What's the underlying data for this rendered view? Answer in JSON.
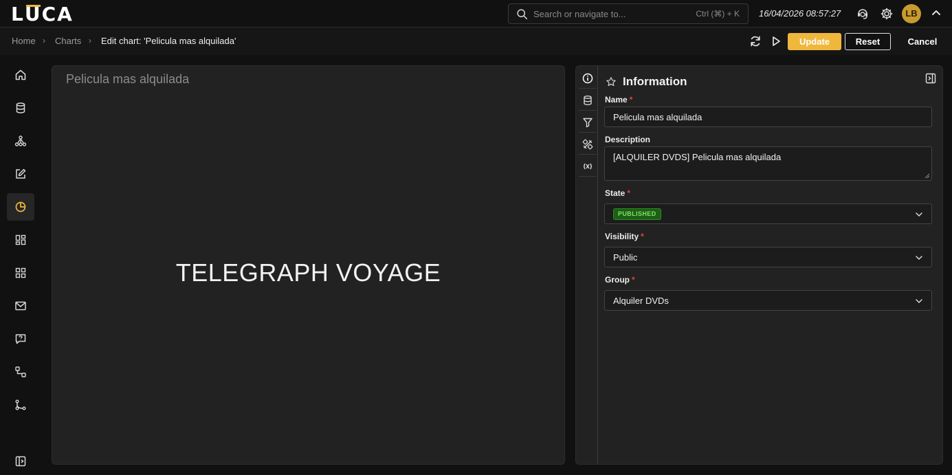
{
  "app": {
    "logo": "LUCA",
    "search_placeholder": "Search or navigate to...",
    "search_shortcut": "Ctrl (⌘) + K",
    "datetime": "16/04/2026 08:57:27",
    "avatar_initials": "LB",
    "accent_color": "#f0b73d"
  },
  "breadcrumb": {
    "items": [
      "Home",
      "Charts"
    ],
    "current": "Edit chart: 'Pelicula mas alquilada'"
  },
  "actions": {
    "update_label": "Update",
    "reset_label": "Reset",
    "cancel_label": "Cancel"
  },
  "sidebar": {
    "items": [
      "home-icon",
      "database-icon",
      "hierarchy-icon",
      "edit-icon",
      "chart-pie-icon",
      "dashboard-icon",
      "grid-icon",
      "mail-icon",
      "chat-icon",
      "workflow-icon",
      "branch-icon"
    ],
    "active_index": 4
  },
  "chart": {
    "title": "Pelicula mas alquilada",
    "value": "TELEGRAPH VOYAGE"
  },
  "properties": {
    "section_title": "Information",
    "name": {
      "label": "Name",
      "value": "Pelicula mas alquilada"
    },
    "description": {
      "label": "Description",
      "value": "[ALQUILER DVDS] Pelicula mas alquilada"
    },
    "state": {
      "label": "State",
      "value": "PUBLISHED"
    },
    "visibility": {
      "label": "Visibility",
      "value": "Public"
    },
    "group": {
      "label": "Group",
      "value": "Alquiler DVDs"
    },
    "required_mark": "*"
  }
}
